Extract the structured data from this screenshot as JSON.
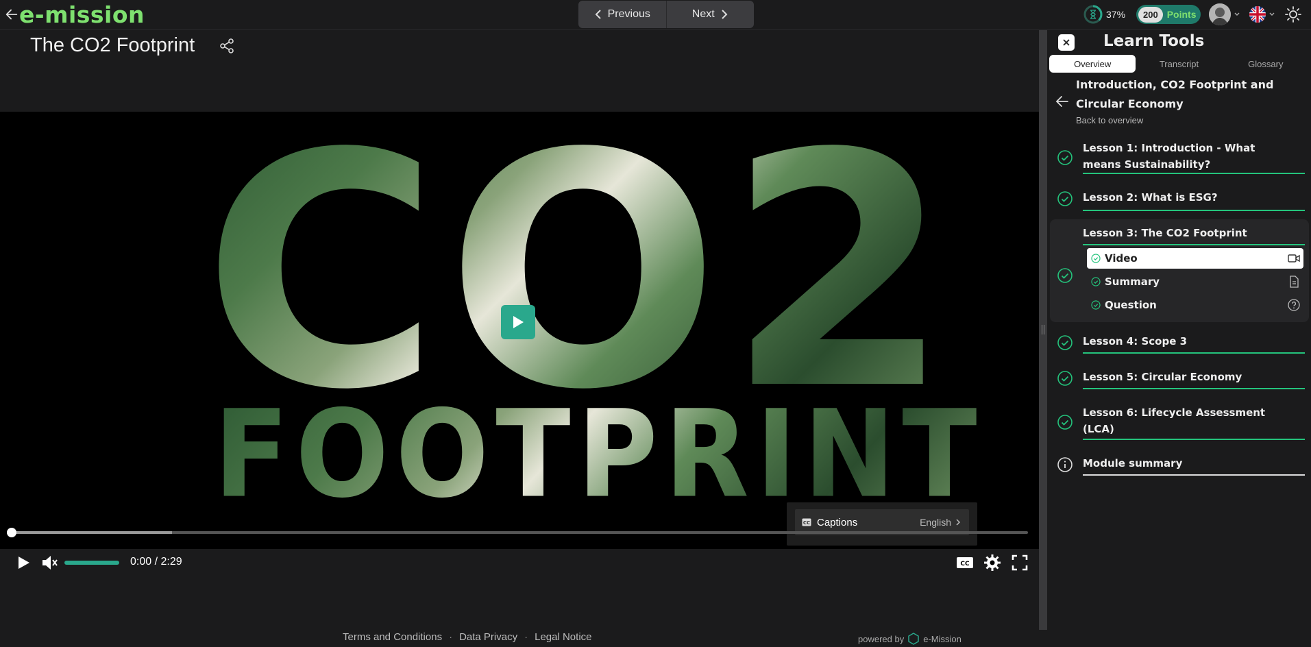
{
  "header": {
    "logo": "e-mission",
    "nav": {
      "previous_label": "Previous",
      "next_label": "Next"
    },
    "progress_percent": "37%",
    "points_value": "200",
    "points_label": "Points"
  },
  "page": {
    "title": "The CO2 Footprint"
  },
  "video": {
    "text_line1": "CO2",
    "text_line2": "FOOTPRINT",
    "time": "0:00 / 2:29",
    "progress_fraction": 0,
    "captions_menu": {
      "label": "Captions",
      "value": "English"
    }
  },
  "footer": {
    "links": [
      "Terms and Conditions",
      "Data Privacy",
      "Legal Notice"
    ],
    "separator": "·",
    "powered_by": "powered by",
    "brand": "e-Mission"
  },
  "panel": {
    "title": "Learn Tools",
    "tabs": [
      {
        "label": "Overview",
        "active": true
      },
      {
        "label": "Transcript",
        "active": false
      },
      {
        "label": "Glossary",
        "active": false
      }
    ],
    "course_title": "Introduction, CO2 Footprint and Circular Economy",
    "back_label": "Back to overview",
    "lessons": [
      {
        "label": "Lesson 1: Introduction - What means Sustainability?",
        "status": "completed"
      },
      {
        "label": "Lesson 2: What is ESG?",
        "status": "completed"
      },
      {
        "label": "Lesson 3: The CO2 Footprint",
        "status": "completed",
        "items": [
          {
            "label": "Video",
            "icon": "video-icon",
            "active": true
          },
          {
            "label": "Summary",
            "icon": "document-icon",
            "active": false
          },
          {
            "label": "Question",
            "icon": "question-icon",
            "active": false
          }
        ]
      },
      {
        "label": "Lesson 4: Scope 3",
        "status": "completed"
      },
      {
        "label": "Lesson 5: Circular Economy",
        "status": "completed"
      },
      {
        "label": "Lesson 6: Lifecycle Assessment (LCA)",
        "status": "completed"
      },
      {
        "label": "Module summary",
        "status": "info"
      }
    ]
  },
  "colors": {
    "accent": "#7ee06f",
    "teal": "#2aa88c",
    "underline": "#24c47c",
    "background": "#1b1b1c"
  }
}
